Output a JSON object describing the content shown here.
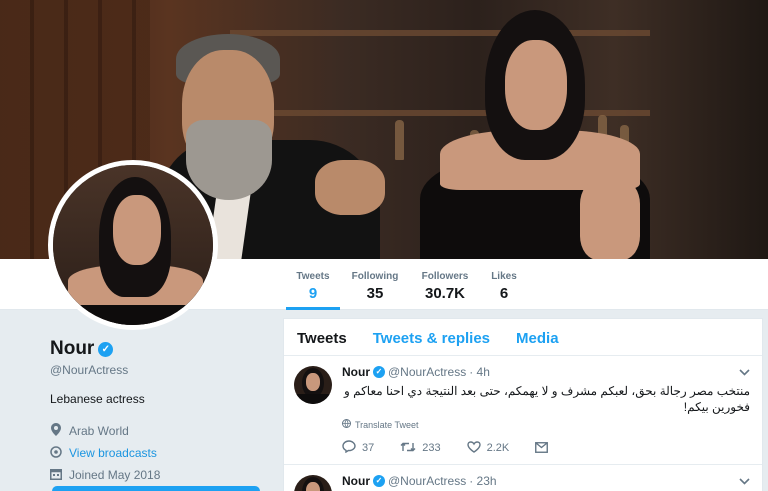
{
  "profile_nav": {
    "stats": [
      {
        "label": "Tweets",
        "value": "9"
      },
      {
        "label": "Following",
        "value": "35"
      },
      {
        "label": "Followers",
        "value": "30.7K"
      },
      {
        "label": "Likes",
        "value": "6"
      }
    ]
  },
  "profile": {
    "name": "Nour",
    "handle": "@NourActress",
    "bio": "Lebanese actress",
    "location": "Arab World",
    "broadcasts_link": "View broadcasts",
    "joined": "Joined May 2018"
  },
  "timeline": {
    "tabs": [
      "Tweets",
      "Tweets & replies",
      "Media"
    ],
    "tweets": [
      {
        "name": "Nour",
        "handle": "@NourActress",
        "time": "· 4h",
        "text": "منتخب مصر رجالة بحق، لعبكم مشرف و لا يهمكم، حتى بعد النتيجة دي احنا معاكم و فخورين بيكم!",
        "translate": "Translate Tweet",
        "replies": "37",
        "retweets": "233",
        "likes": "2.2K"
      },
      {
        "name": "Nour",
        "handle": "@NourActress",
        "time": "· 23h"
      }
    ]
  },
  "icons": {
    "verified": "verified-badge-icon",
    "location": "location-pin-icon",
    "link": "link-icon",
    "calendar": "calendar-icon",
    "reply": "reply-icon",
    "retweet": "retweet-icon",
    "like": "heart-icon",
    "dm": "envelope-icon",
    "globe": "globe-icon",
    "caret": "chevron-down-icon"
  },
  "colors": {
    "accent": "#1da1f2",
    "page_bg": "#e6ecf0",
    "text_secondary": "#657786"
  }
}
